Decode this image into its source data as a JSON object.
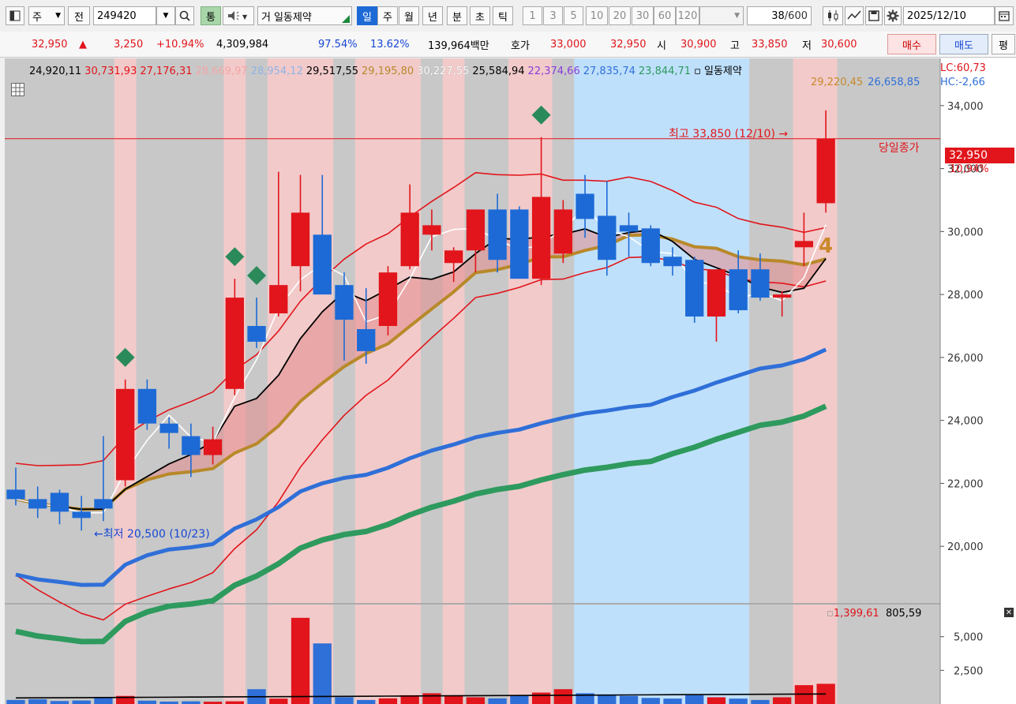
{
  "toolbar": {
    "market_label": "주",
    "period_label": "전",
    "code": "249420",
    "type_button": "통",
    "name_prefix": "거",
    "stock_name": "일동제약",
    "period_tabs": [
      "일",
      "주",
      "월",
      "년",
      "분",
      "초",
      "틱"
    ],
    "selected_tab": "일",
    "interval_tabs": [
      "1",
      "3",
      "5",
      "10",
      "20",
      "30",
      "60",
      "120"
    ],
    "count_value": "38",
    "count_total": "/600",
    "date": "2025/12/10"
  },
  "quote": {
    "price": "32,950",
    "arrow": "▲",
    "change": "3,250",
    "change_pct": "+10.94%",
    "volume": "4,309,984",
    "vol_ratio": "97.54%",
    "turnover": "13.62%",
    "amount": "139,964백만",
    "bid_label": "호가",
    "ask": "33,000",
    "bid": "32,950",
    "open_label": "시",
    "open": "30,900",
    "high_label": "고",
    "high": "33,850",
    "low_label": "저",
    "low": "30,600",
    "buy_button": "매수",
    "sell_button": "매도",
    "eval_button": "평"
  },
  "indicators": {
    "row1": [
      {
        "text": "24,920,11",
        "color": "#000000"
      },
      {
        "text": "30,731,93",
        "color": "#e1151b"
      },
      {
        "text": "27,176,31",
        "color": "#e1151b"
      },
      {
        "text": "28,669,97",
        "color": "#f4a6a6"
      },
      {
        "text": "28,954,12",
        "color": "#8fb4e6"
      },
      {
        "text": "29,517,55",
        "color": "#000000"
      },
      {
        "text": "29,195,80",
        "color": "#b8892a"
      },
      {
        "text": "30,227,55",
        "color": "#ffffff"
      },
      {
        "text": "25,584,94",
        "color": "#000000"
      },
      {
        "text": "22,374,66",
        "color": "#8a3dd9"
      },
      {
        "text": "27,835,74",
        "color": "#2f6fd8"
      },
      {
        "text": "23,844,71",
        "color": "#2e9a5e"
      },
      {
        "text": "일동제약",
        "color": "#000000"
      }
    ],
    "row2": [
      {
        "text": "29,220,45",
        "color": "#c9892a"
      },
      {
        "text": "26,658,85",
        "color": "#2f6fd8"
      }
    ],
    "lc": "LC:60,73",
    "hc": "HC:-2,66"
  },
  "annotations": {
    "high_note": "최고 33,850 (12/10)",
    "low_note": "최저 20,500 (10/23)",
    "close_note": "당일종가",
    "price_tag": "32,950",
    "pct_tag": "10,94%",
    "signal_digit": "4"
  },
  "volume_header": {
    "a": "1,399,61",
    "b": "805,59"
  },
  "chart_data": {
    "type": "candlestick",
    "price_axis": {
      "ticks": [
        20000,
        22000,
        24000,
        26000,
        28000,
        30000,
        32000,
        34000
      ],
      "labels": [
        "20,000",
        "22,000",
        "24,000",
        "26,000",
        "28,000",
        "30,000",
        "32,000",
        "34,000"
      ],
      "range": [
        18200,
        35500
      ]
    },
    "volume_axis": {
      "ticks": [
        2500,
        5000
      ],
      "labels": [
        "2,500",
        "5,000"
      ],
      "range": [
        0,
        6800
      ]
    },
    "candles": [
      {
        "o": 21800,
        "h": 22500,
        "l": 21300,
        "c": 21500
      },
      {
        "o": 21500,
        "h": 21900,
        "l": 20900,
        "c": 21200
      },
      {
        "o": 21700,
        "h": 21800,
        "l": 20700,
        "c": 21100
      },
      {
        "o": 21100,
        "h": 21600,
        "l": 20500,
        "c": 20900
      },
      {
        "o": 21500,
        "h": 23500,
        "l": 20800,
        "c": 21200
      },
      {
        "o": 22100,
        "h": 25300,
        "l": 21900,
        "c": 25000
      },
      {
        "o": 25000,
        "h": 25300,
        "l": 23700,
        "c": 23900
      },
      {
        "o": 23900,
        "h": 24100,
        "l": 23100,
        "c": 23600
      },
      {
        "o": 23500,
        "h": 23900,
        "l": 22200,
        "c": 22900
      },
      {
        "o": 22900,
        "h": 23800,
        "l": 22600,
        "c": 23400
      },
      {
        "o": 25000,
        "h": 28500,
        "l": 24800,
        "c": 27900
      },
      {
        "o": 27000,
        "h": 27900,
        "l": 26300,
        "c": 26500
      },
      {
        "o": 27400,
        "h": 31900,
        "l": 27300,
        "c": 28300
      },
      {
        "o": 28900,
        "h": 31800,
        "l": 28100,
        "c": 30600
      },
      {
        "o": 29900,
        "h": 31800,
        "l": 28400,
        "c": 28000
      },
      {
        "o": 28300,
        "h": 28700,
        "l": 25900,
        "c": 27200
      },
      {
        "o": 26900,
        "h": 28200,
        "l": 25800,
        "c": 26200
      },
      {
        "o": 27000,
        "h": 28900,
        "l": 26700,
        "c": 28700
      },
      {
        "o": 28900,
        "h": 31500,
        "l": 28800,
        "c": 30600
      },
      {
        "o": 29900,
        "h": 30700,
        "l": 29400,
        "c": 30200
      },
      {
        "o": 29000,
        "h": 29500,
        "l": 28400,
        "c": 29400
      },
      {
        "o": 29400,
        "h": 30400,
        "l": 28700,
        "c": 30700
      },
      {
        "o": 30700,
        "h": 31200,
        "l": 28700,
        "c": 29100
      },
      {
        "o": 30700,
        "h": 30800,
        "l": 28800,
        "c": 28500
      },
      {
        "o": 28500,
        "h": 33000,
        "l": 28300,
        "c": 31100
      },
      {
        "o": 29300,
        "h": 31000,
        "l": 29000,
        "c": 30700
      },
      {
        "o": 31200,
        "h": 31800,
        "l": 29800,
        "c": 30400
      },
      {
        "o": 30500,
        "h": 31600,
        "l": 28600,
        "c": 29100
      },
      {
        "o": 30200,
        "h": 30600,
        "l": 29200,
        "c": 30000
      },
      {
        "o": 30100,
        "h": 30200,
        "l": 28900,
        "c": 29000
      },
      {
        "o": 29200,
        "h": 29500,
        "l": 28600,
        "c": 28900
      },
      {
        "o": 29100,
        "h": 29200,
        "l": 27100,
        "c": 27300
      },
      {
        "o": 27300,
        "h": 28800,
        "l": 26500,
        "c": 28800
      },
      {
        "o": 28800,
        "h": 29400,
        "l": 27400,
        "c": 27500
      },
      {
        "o": 28800,
        "h": 29300,
        "l": 27800,
        "c": 27900
      },
      {
        "o": 27900,
        "h": 28100,
        "l": 27300,
        "c": 28000
      },
      {
        "o": 29500,
        "h": 30600,
        "l": 28900,
        "c": 29700
      },
      {
        "o": 30900,
        "h": 33850,
        "l": 30600,
        "c": 32950
      }
    ],
    "volumes": [
      300,
      350,
      220,
      260,
      520,
      600,
      250,
      180,
      200,
      170,
      200,
      1100,
      400,
      6400,
      4500,
      500,
      300,
      420,
      650,
      800,
      600,
      500,
      420,
      600,
      850,
      1100,
      800,
      700,
      600,
      450,
      400,
      650,
      500,
      400,
      300,
      500,
      1400,
      1500
    ],
    "background_bands": [
      "gray",
      "gray",
      "gray",
      "gray",
      "gray",
      "pink",
      "gray",
      "gray",
      "gray",
      "gray",
      "pink",
      "gray",
      "pink",
      "pink",
      "pink",
      "gray",
      "pink",
      "pink",
      "pink",
      "gray",
      "pink",
      "gray",
      "gray",
      "pink",
      "pink",
      "gray",
      "blue",
      "blue",
      "blue",
      "blue",
      "blue",
      "blue",
      "blue",
      "blue",
      "gray",
      "gray",
      "pink",
      "pink"
    ]
  }
}
